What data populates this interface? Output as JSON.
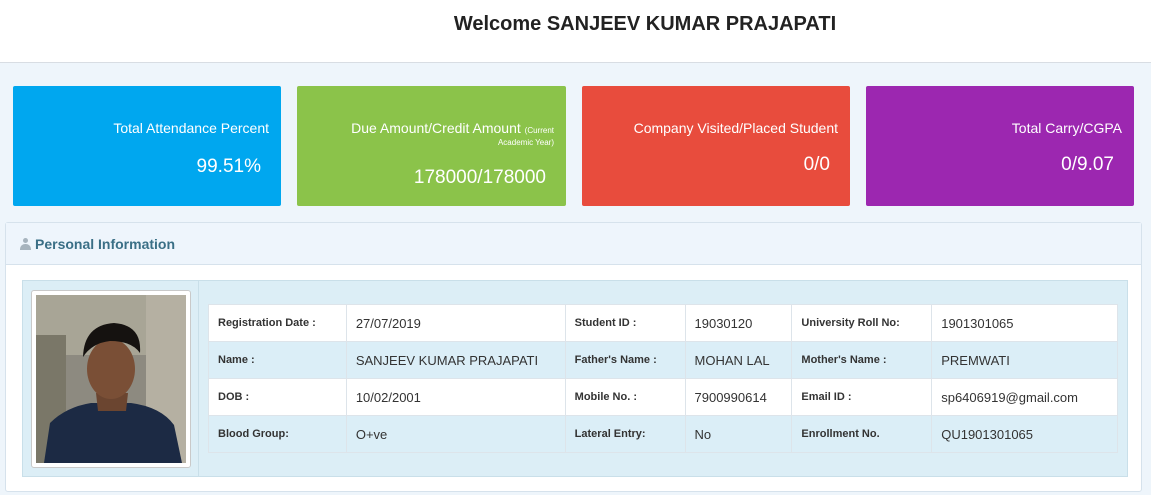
{
  "header": {
    "welcome": "Welcome SANJEEV KUMAR PRAJAPATI"
  },
  "tiles": [
    {
      "title": "Total Attendance Percent",
      "value": "99.51%",
      "color": "#00a7ef"
    },
    {
      "title": "Due Amount/Credit Amount",
      "note_line1": "(Current",
      "note_line2": "Academic Year)",
      "value": "178000/178000",
      "color": "#8bc34a"
    },
    {
      "title": "Company Visited/Placed Student",
      "value": "0/0",
      "color": "#e84c3d"
    },
    {
      "title": "Total Carry/CGPA",
      "value": "0/9.07",
      "color": "#9c27b0"
    }
  ],
  "panel": {
    "title": "Personal Information",
    "icon": "user-icon"
  },
  "info": {
    "rows": [
      [
        {
          "label": "Registration Date :",
          "value": "27/07/2019"
        },
        {
          "label": "Student ID :",
          "value": "19030120"
        },
        {
          "label": "University Roll No:",
          "value": "1901301065"
        }
      ],
      [
        {
          "label": "Name :",
          "value": "SANJEEV KUMAR PRAJAPATI"
        },
        {
          "label": "Father's Name :",
          "value": "MOHAN LAL"
        },
        {
          "label": "Mother's Name :",
          "value": "PREMWATI"
        }
      ],
      [
        {
          "label": "DOB :",
          "value": "10/02/2001"
        },
        {
          "label": "Mobile No. :",
          "value": "7900990614"
        },
        {
          "label": "Email ID :",
          "value": "sp6406919@gmail.com"
        }
      ],
      [
        {
          "label": "Blood Group:",
          "value": "O+ve"
        },
        {
          "label": "Lateral Entry:",
          "value": "No"
        },
        {
          "label": "Enrollment No.",
          "value": "QU1901301065"
        }
      ]
    ]
  }
}
